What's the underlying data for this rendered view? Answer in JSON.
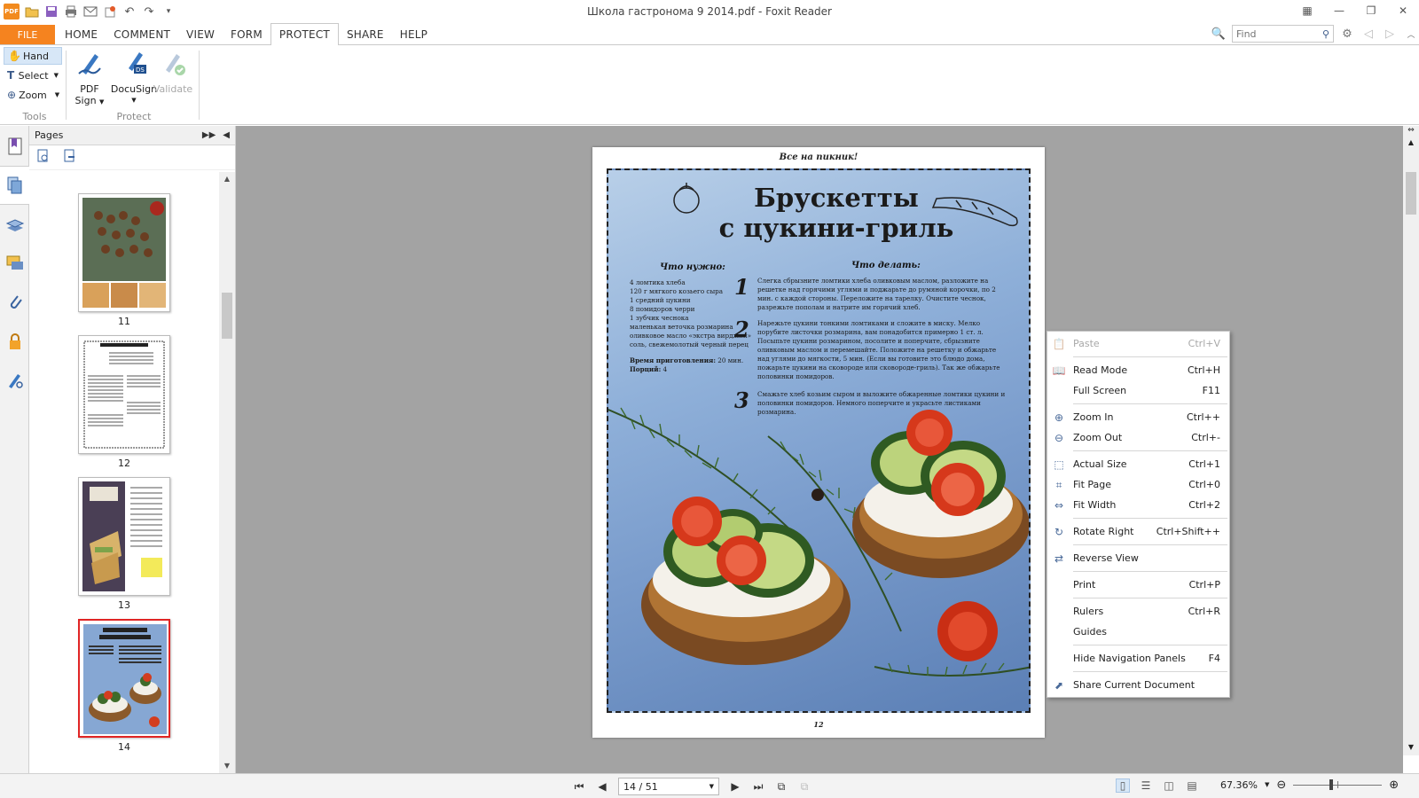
{
  "window": {
    "title": "Школа гастронома 9 2014.pdf - Foxit Reader",
    "app_logo_text": "PDF"
  },
  "quick_access": [
    "open-icon",
    "save-icon",
    "print-icon",
    "email-icon",
    "new-icon",
    "undo-icon",
    "redo-icon",
    "customize-icon"
  ],
  "menu": {
    "file_label": "FILE",
    "tabs": [
      {
        "label": "HOME",
        "active": false
      },
      {
        "label": "COMMENT",
        "active": false
      },
      {
        "label": "VIEW",
        "active": false
      },
      {
        "label": "FORM",
        "active": false
      },
      {
        "label": "PROTECT",
        "active": true
      },
      {
        "label": "SHARE",
        "active": false
      },
      {
        "label": "HELP",
        "active": false
      }
    ]
  },
  "find": {
    "placeholder": "Find"
  },
  "ribbon": {
    "tools": {
      "hand_label": "Hand",
      "select_label": "Select",
      "zoom_label": "Zoom",
      "group_label": "Tools"
    },
    "protect": {
      "pdf_sign_label": "PDF",
      "pdf_sign_label2": "Sign",
      "docusign_label": "DocuSign",
      "validate_label": "Validate",
      "group_label": "Protect"
    }
  },
  "pages_panel": {
    "title": "Pages",
    "thumbnails": [
      {
        "label": "11",
        "selected": false
      },
      {
        "label": "12",
        "selected": false
      },
      {
        "label": "13",
        "selected": false
      },
      {
        "label": "14",
        "selected": true
      }
    ]
  },
  "document": {
    "header": "Все на пикник!",
    "footer": "12",
    "title_line1": "Брускетты",
    "title_line2": "с цукини-гриль",
    "ingredients_head": "Что нужно:",
    "steps_head": "Что делать:",
    "ingredients": [
      "4 ломтика хлеба",
      "120 г мягкого козьего сыра",
      "1 средний цукини",
      "8 помидоров черри",
      "1 зубчик чеснока",
      "маленькая веточка розмарина",
      "оливковое масло «экстра вирджин»",
      "соль, свежемолотый черный перец"
    ],
    "prep_time_label": "Время приготовления:",
    "prep_time_value": "20 мин.",
    "portions_label": "Порций:",
    "portions_value": "4",
    "steps": [
      {
        "num": "1",
        "text": "Слегка сбрызните ломтики хлеба оливковым маслом, разложите на решетке над горячими углями и поджарьте до румяной корочки, по 2 мин. с каждой стороны. Переложите на тарелку. Очистите чеснок, разрежьте пополам и натрите им горячий хлеб."
      },
      {
        "num": "2",
        "text": "Нарежьте цукини тонкими ломтиками и сложите в миску. Мелко порубите листочки розмарина, вам понадобится примерно 1 ст. л. Посыпьте цукини розмарином, посолите и поперчите, сбрызните оливковым маслом и перемешайте. Положите на решетку и обжарьте над углями до мягкости, 5 мин. (Если вы готовите это блюдо дома, пожарьте цукини на сковороде или сковороде-гриль). Так же обжарьте половинки помидоров."
      },
      {
        "num": "3",
        "text": "Смажьте хлеб козьим сыром и выложите обжаренные ломтики цукини и половинки помидоров. Немного поперчите и украсьте листиками розмарина."
      }
    ]
  },
  "context_menu": [
    {
      "type": "item",
      "label": "Paste",
      "shortcut": "Ctrl+V",
      "disabled": true,
      "icon": "paste-icon"
    },
    {
      "type": "sep"
    },
    {
      "type": "item",
      "label": "Read Mode",
      "shortcut": "Ctrl+H",
      "disabled": false,
      "icon": "book-icon"
    },
    {
      "type": "item",
      "label": "Full Screen",
      "shortcut": "F11",
      "disabled": false,
      "icon": ""
    },
    {
      "type": "sep"
    },
    {
      "type": "item",
      "label": "Zoom In",
      "shortcut": "Ctrl++",
      "disabled": false,
      "icon": "zoom-in-icon"
    },
    {
      "type": "item",
      "label": "Zoom Out",
      "shortcut": "Ctrl+-",
      "disabled": false,
      "icon": "zoom-out-icon"
    },
    {
      "type": "sep"
    },
    {
      "type": "item",
      "label": "Actual Size",
      "shortcut": "Ctrl+1",
      "disabled": false,
      "icon": "actual-size-icon"
    },
    {
      "type": "item",
      "label": "Fit Page",
      "shortcut": "Ctrl+0",
      "disabled": false,
      "icon": "fit-page-icon"
    },
    {
      "type": "item",
      "label": "Fit Width",
      "shortcut": "Ctrl+2",
      "disabled": false,
      "icon": "fit-width-icon"
    },
    {
      "type": "sep"
    },
    {
      "type": "item",
      "label": "Rotate Right",
      "shortcut": "Ctrl+Shift++",
      "disabled": false,
      "icon": "rotate-right-icon"
    },
    {
      "type": "sep"
    },
    {
      "type": "item",
      "label": "Reverse View",
      "shortcut": "",
      "disabled": false,
      "icon": "reverse-view-icon"
    },
    {
      "type": "sep"
    },
    {
      "type": "item",
      "label": "Print",
      "shortcut": "Ctrl+P",
      "disabled": false,
      "icon": ""
    },
    {
      "type": "sep"
    },
    {
      "type": "item",
      "label": "Rulers",
      "shortcut": "Ctrl+R",
      "disabled": false,
      "icon": ""
    },
    {
      "type": "item",
      "label": "Guides",
      "shortcut": "",
      "disabled": false,
      "icon": ""
    },
    {
      "type": "sep"
    },
    {
      "type": "item",
      "label": "Hide Navigation Panels",
      "shortcut": "F4",
      "disabled": false,
      "icon": ""
    },
    {
      "type": "sep"
    },
    {
      "type": "item",
      "label": "Share Current Document",
      "shortcut": "",
      "disabled": false,
      "icon": "share-icon"
    }
  ],
  "statusbar": {
    "page_value": "14 / 51",
    "zoom_value": "67.36%",
    "zoom_slider_fraction": 0.42
  },
  "colors": {
    "accent": "#f5831f",
    "selection": "#d7e7f7",
    "thumb_selected": "#e02424",
    "doc_bg": "#a3a3a3"
  }
}
